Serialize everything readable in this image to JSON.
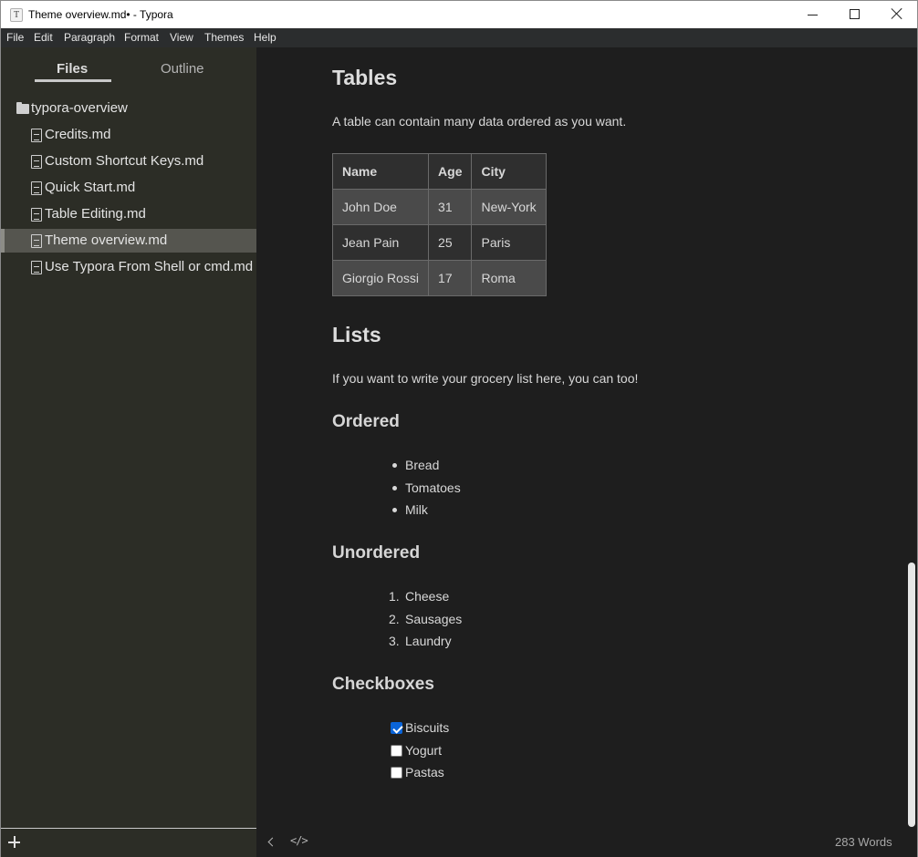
{
  "window": {
    "app_icon_letter": "T",
    "title": "Theme overview.md• - Typora"
  },
  "menu": [
    "File",
    "Edit",
    "Paragraph",
    "Format",
    "View",
    "Themes",
    "Help"
  ],
  "sidebar": {
    "tabs": {
      "files": "Files",
      "outline": "Outline"
    },
    "active_tab": "files",
    "folder": "typora-overview",
    "files": [
      "Credits.md",
      "Custom Shortcut Keys.md",
      "Quick Start.md",
      "Table Editing.md",
      "Theme overview.md",
      "Use Typora From Shell or cmd.md"
    ],
    "active_file": "Theme overview.md"
  },
  "document": {
    "tables_heading": "Tables",
    "tables_text": "A table can contain many data ordered as you want.",
    "table": {
      "headers": [
        "Name",
        "Age",
        "City"
      ],
      "rows": [
        [
          "John Doe",
          "31",
          "New-York"
        ],
        [
          "Jean Pain",
          "25",
          "Paris"
        ],
        [
          "Giorgio Rossi",
          "17",
          "Roma"
        ]
      ]
    },
    "lists_heading": "Lists",
    "lists_text": "If you want to write your grocery list here, you can too!",
    "ordered_heading": "Ordered",
    "ordered_items": [
      "Bread",
      "Tomatoes",
      "Milk"
    ],
    "unordered_heading": "Unordered",
    "unordered_items": [
      "Cheese",
      "Sausages",
      "Laundry"
    ],
    "unordered_numbers": [
      "1.",
      "2.",
      "3."
    ],
    "checkboxes_heading": "Checkboxes",
    "checkbox_items": [
      {
        "label": "Biscuits",
        "checked": true
      },
      {
        "label": "Yogurt",
        "checked": false
      },
      {
        "label": "Pastas",
        "checked": false
      }
    ]
  },
  "status": {
    "word_count": "283 Words"
  },
  "colors": {
    "sidebar_bg": "#2c2d26",
    "editor_bg": "#1e1e1e",
    "menubar_bg": "#2b2d2e",
    "checkbox_accent": "#0a64d8"
  }
}
